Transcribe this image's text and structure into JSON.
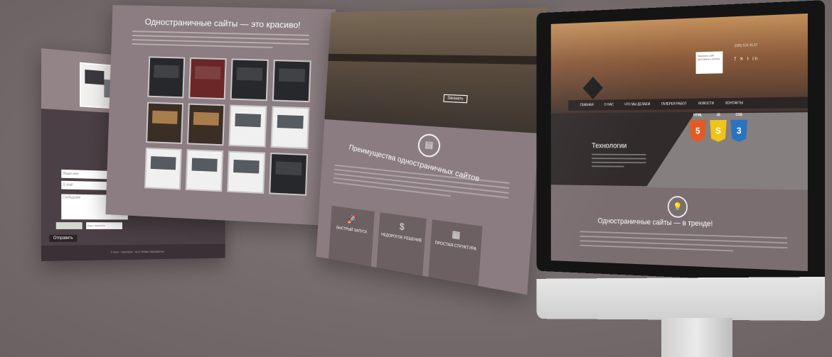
{
  "panel1": {
    "field1": "Ваше имя",
    "field2": "E-mail",
    "message": "Сообщение",
    "captcha_placeholder": "Код с картинки",
    "send": "Отправить",
    "footer": "© 2014 · ONEPAGE · ВСЕ ПРАВА ЗАЩИЩЕНЫ"
  },
  "panel2": {
    "title": "Одностраничные сайты — это красиво!"
  },
  "panel3": {
    "hero_button": "Заказать",
    "title": "Преимущества одностраничных сайтов",
    "cards": [
      {
        "icon": "🚀",
        "label": "БЫСТРЫЙ ЗАПУСК"
      },
      {
        "icon": "$",
        "label": "НЕДОРОГОЕ РЕШЕНИЕ"
      },
      {
        "icon": "▦",
        "label": "ПРОСТАЯ СТРУКТУРА"
      }
    ]
  },
  "imac": {
    "contact_lines": "Заказать сайт\nДоставка и оплата",
    "phone": "(096) 524 45 67",
    "social": "f ✕ t in",
    "nav": [
      "ГЛАВНАЯ",
      "О НАС",
      "ЧТО МЫ ДЕЛАЕМ",
      "ГАЛЕРЕЯ РАБОТ",
      "НОВОСТИ",
      "КОНТАКТЫ"
    ],
    "tech_title": "Технологии",
    "tech_icons": [
      {
        "label": "HTML",
        "num": "5",
        "color": "#e35a25"
      },
      {
        "label": "JS",
        "num": "S",
        "color": "#f0c419"
      },
      {
        "label": "CSS",
        "num": "3",
        "color": "#2a73bf"
      }
    ],
    "trend_title": "Одностраничные сайты — в тренде!",
    "apple": ""
  }
}
